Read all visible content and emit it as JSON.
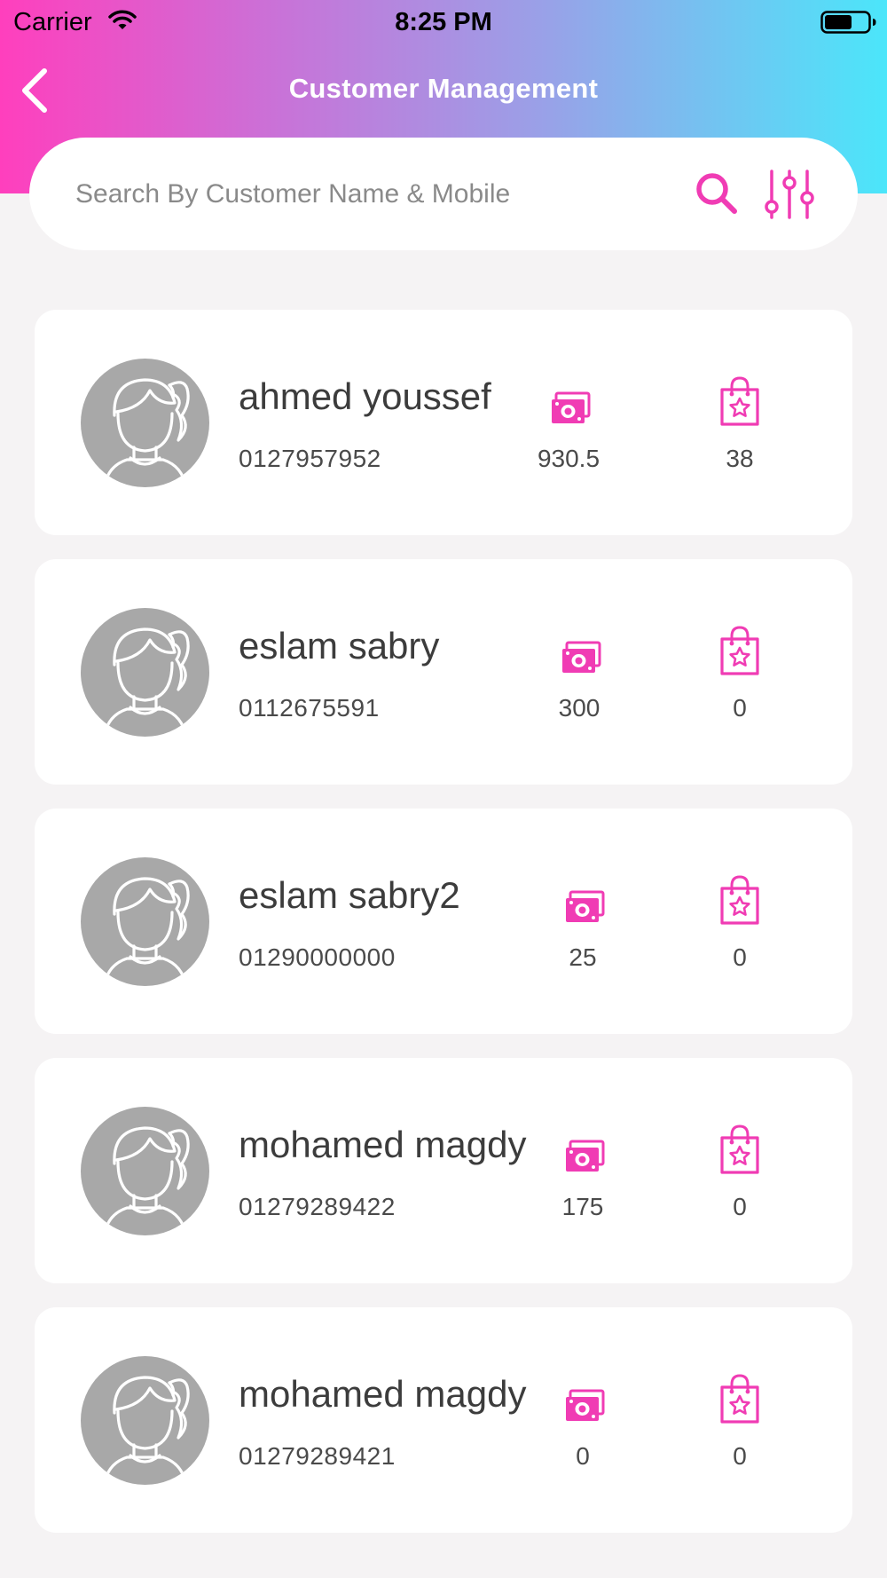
{
  "status_bar": {
    "carrier": "Carrier",
    "time": "8:25 PM"
  },
  "header": {
    "title": "Customer Management"
  },
  "search": {
    "placeholder": "Search By Customer Name & Mobile",
    "value": ""
  },
  "colors": {
    "accent": "#f03cb4",
    "avatar_gray": "#a8a8a8"
  },
  "icons": {
    "back": "chevron-left-icon",
    "search": "search-icon",
    "filter": "sliders-icon",
    "money": "money-icon",
    "orders": "shopping-bag-star-icon",
    "avatar": "avatar-placeholder-icon"
  },
  "customers": [
    {
      "name": "ahmed youssef",
      "mobile": "0127957952",
      "money": "930.5",
      "orders": "38"
    },
    {
      "name": "eslam sabry",
      "mobile": "0112675591",
      "money": "300",
      "orders": "0"
    },
    {
      "name": "eslam sabry2",
      "mobile": "01290000000",
      "money": "25",
      "orders": "0"
    },
    {
      "name": "mohamed magdy",
      "mobile": "01279289422",
      "money": "175",
      "orders": "0"
    },
    {
      "name": "mohamed magdy",
      "mobile": "01279289421",
      "money": "0",
      "orders": "0"
    }
  ]
}
